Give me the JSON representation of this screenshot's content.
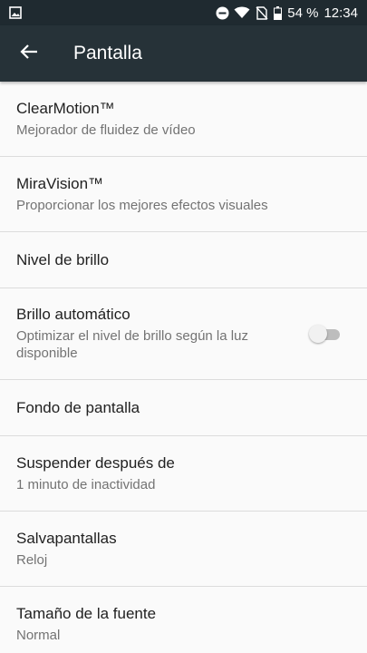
{
  "status_bar": {
    "battery_percent": "54 %",
    "time": "12:34",
    "icons": [
      "image-icon",
      "dnd-icon",
      "wifi-icon",
      "no-sim-icon",
      "battery-icon"
    ]
  },
  "app_bar": {
    "title": "Pantalla",
    "back_icon": "back-arrow-icon"
  },
  "settings": [
    {
      "title": "ClearMotion™",
      "summary": "Mejorador de fluidez de vídeo"
    },
    {
      "title": "MiraVision™",
      "summary": "Proporcionar los mejores efectos visuales"
    },
    {
      "title": "Nivel de brillo"
    },
    {
      "title": "Brillo automático",
      "summary": "Optimizar el nivel de brillo según la luz disponible",
      "toggle_on": false
    },
    {
      "title": "Fondo de pantalla"
    },
    {
      "title": "Suspender después de",
      "summary": "1 minuto de inactividad"
    },
    {
      "title": "Salvapantallas",
      "summary": "Reloj"
    },
    {
      "title": "Tamaño de la fuente",
      "summary": "Normal"
    }
  ],
  "colors": {
    "status_bar": "#1f2a30",
    "app_bar": "#263238",
    "background": "#fafafa",
    "divider": "#dcdcdc"
  }
}
